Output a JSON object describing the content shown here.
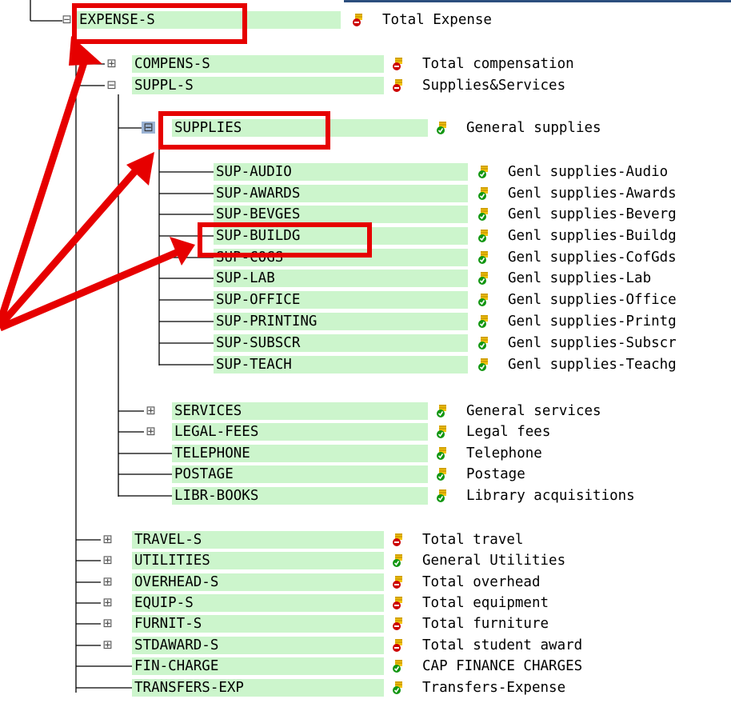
{
  "tree": {
    "root": {
      "code": "EXPENSE-S",
      "desc": "Total Expense",
      "status": "red"
    },
    "nodes": [
      {
        "code": "COMPENS-S",
        "desc": "Total compensation",
        "status": "red"
      },
      {
        "code": "SUPPL-S",
        "desc": "Supplies&Services",
        "status": "red"
      },
      {
        "code": "SUPPLIES",
        "desc": "General supplies",
        "status": "green"
      },
      {
        "code": "SUP-AUDIO",
        "desc": "Genl supplies-Audio",
        "status": "green"
      },
      {
        "code": "SUP-AWARDS",
        "desc": "Genl supplies-Awards",
        "status": "green"
      },
      {
        "code": "SUP-BEVGES",
        "desc": "Genl supplies-Beverg",
        "status": "green"
      },
      {
        "code": "SUP-BUILDG",
        "desc": "Genl supplies-Buildg",
        "status": "green"
      },
      {
        "code": "SUP-COGS",
        "desc": "Genl supplies-CofGds",
        "status": "green"
      },
      {
        "code": "SUP-LAB",
        "desc": "Genl supplies-Lab",
        "status": "green"
      },
      {
        "code": "SUP-OFFICE",
        "desc": "Genl supplies-Office",
        "status": "green"
      },
      {
        "code": "SUP-PRINTING",
        "desc": "Genl supplies-Printg",
        "status": "green"
      },
      {
        "code": "SUP-SUBSCR",
        "desc": "Genl supplies-Subscr",
        "status": "green"
      },
      {
        "code": "SUP-TEACH",
        "desc": "Genl supplies-Teachg",
        "status": "green"
      },
      {
        "code": "SERVICES",
        "desc": "General services",
        "status": "green"
      },
      {
        "code": "LEGAL-FEES",
        "desc": "Legal fees",
        "status": "green"
      },
      {
        "code": "TELEPHONE",
        "desc": "Telephone",
        "status": "green"
      },
      {
        "code": "POSTAGE",
        "desc": "Postage",
        "status": "green"
      },
      {
        "code": "LIBR-BOOKS",
        "desc": "Library acquisitions",
        "status": "green"
      },
      {
        "code": "TRAVEL-S",
        "desc": "Total travel",
        "status": "red"
      },
      {
        "code": "UTILITIES",
        "desc": "General Utilities",
        "status": "green"
      },
      {
        "code": "OVERHEAD-S",
        "desc": "Total overhead",
        "status": "red"
      },
      {
        "code": "EQUIP-S",
        "desc": "Total equipment",
        "status": "red"
      },
      {
        "code": "FURNIT-S",
        "desc": "Total furniture",
        "status": "red"
      },
      {
        "code": "STDAWARD-S",
        "desc": "Total student award",
        "status": "red"
      },
      {
        "code": "FIN-CHARGE",
        "desc": "CAP FINANCE CHARGES",
        "status": "green"
      },
      {
        "code": "TRANSFERS-EXP",
        "desc": "Transfers-Expense",
        "status": "green"
      }
    ]
  },
  "colors": {
    "node_background": "#ccf5cc",
    "highlight": "#e60000",
    "status_red": "#cc0000",
    "status_green": "#129612",
    "status_base": "#f2c20a"
  },
  "icons": {
    "collapsed_folder": "folder-plus-icon",
    "expanded_folder": "folder-open-icon",
    "status_red": "status-red-icon",
    "status_green": "status-green-icon"
  }
}
